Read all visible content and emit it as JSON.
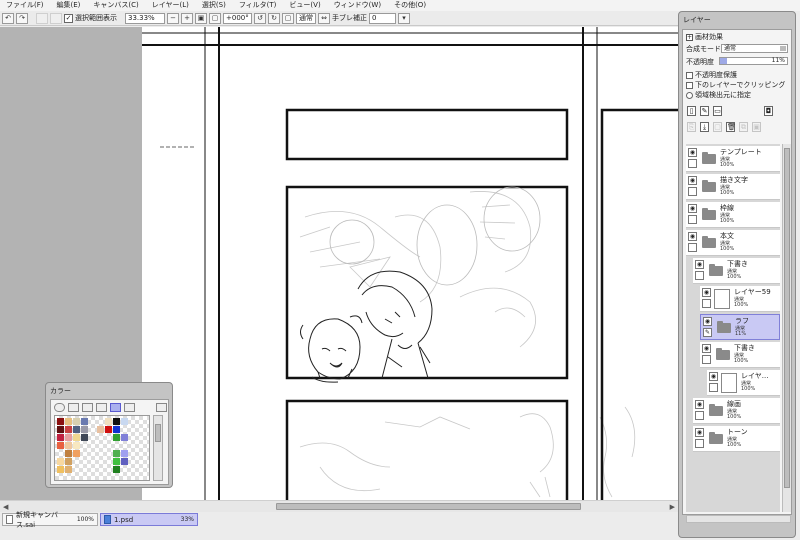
{
  "menu": [
    "ファイル(F)",
    "編集(E)",
    "キャンバス(C)",
    "レイヤー(L)",
    "選択(S)",
    "フィルタ(T)",
    "ビュー(V)",
    "ウィンドウ(W)",
    "その他(O)"
  ],
  "toolbar": {
    "selection_label": "選択範囲表示",
    "zoom": "33.33%",
    "rotation": "+000°",
    "mode": "通常",
    "stabilizer_label": "手ブレ補正",
    "stabilizer_value": "0"
  },
  "layer_panel": {
    "title": "レイヤー",
    "texture_effect_label": "画材効果",
    "blend_mode_label": "合成モード",
    "blend_mode_value": "通常",
    "opacity_label": "不透明度",
    "opacity_value": "11%",
    "opacity_fraction": 0.11,
    "option_preserve_opacity": "不透明度保護",
    "option_clipping": "下のレイヤーでクリッピング",
    "option_selection_source": "領域検出元に指定",
    "layers": [
      {
        "name": "テンプレート",
        "mode": "通常",
        "opacity": "100%",
        "kind": "folder",
        "indent": 0,
        "selected": false
      },
      {
        "name": "描き文字",
        "mode": "通常",
        "opacity": "100%",
        "kind": "folder",
        "indent": 0,
        "selected": false
      },
      {
        "name": "枠線",
        "mode": "通常",
        "opacity": "100%",
        "kind": "folder",
        "indent": 0,
        "selected": false
      },
      {
        "name": "本文",
        "mode": "通常",
        "opacity": "100%",
        "kind": "folder",
        "indent": 0,
        "selected": false
      },
      {
        "name": "下書き",
        "mode": "通常",
        "opacity": "100%",
        "kind": "folder",
        "indent": 1,
        "selected": false
      },
      {
        "name": "レイヤー59",
        "mode": "通常",
        "opacity": "100%",
        "kind": "layer",
        "indent": 2,
        "selected": false
      },
      {
        "name": "ラフ",
        "mode": "通常",
        "opacity": "11%",
        "kind": "folder",
        "indent": 2,
        "selected": true
      },
      {
        "name": "下書き",
        "mode": "通常",
        "opacity": "100%",
        "kind": "folder",
        "indent": 2,
        "selected": false
      },
      {
        "name": "レイヤ...",
        "mode": "通常",
        "opacity": "100%",
        "kind": "layer",
        "indent": 3,
        "selected": false
      },
      {
        "name": "線画",
        "mode": "通常",
        "opacity": "100%",
        "kind": "folder",
        "indent": 1,
        "selected": false
      },
      {
        "name": "トーン",
        "mode": "通常",
        "opacity": "100%",
        "kind": "folder",
        "indent": 1,
        "selected": false
      }
    ]
  },
  "color_panel": {
    "title": "カラー",
    "swatches": [
      [
        "#8b1010",
        "#e8c080",
        "#d8d0b0",
        "#6a7ab0",
        "",
        "",
        "#f0e0c0",
        "#101010",
        "#c8d8f0"
      ],
      [
        "#601010",
        "#c84040",
        "#506080",
        "#9a9aa8",
        "",
        "#e8c0a0",
        "#d01010",
        "#1030d0",
        ""
      ],
      [
        "#c02040",
        "#e8a0a0",
        "#f0d890",
        "#404858",
        "",
        "",
        "",
        "#30a030",
        "#8080d8"
      ],
      [
        "#e86040",
        "#f0c8a0",
        "#f8e8c0",
        "",
        "",
        "",
        "",
        "",
        ""
      ],
      [
        "",
        "#c08040",
        "#f0a060",
        "",
        "",
        "",
        "",
        "#50b050",
        "#a0a0f0"
      ],
      [
        "#f8d8a0",
        "#d0a060",
        "",
        "",
        "",
        "",
        "",
        "#40c040",
        "#6060c0"
      ],
      [
        "#f0c060",
        "#e0b070",
        "",
        "",
        "",
        "",
        "",
        "#208020",
        ""
      ]
    ]
  },
  "documents": [
    {
      "name": "新規キャンバス.sai",
      "zoom": "100%",
      "active": false
    },
    {
      "name": "1.psd",
      "zoom": "33%",
      "active": true
    }
  ],
  "canvas": {
    "left_arrow": "◀",
    "right_arrow": "▶"
  }
}
